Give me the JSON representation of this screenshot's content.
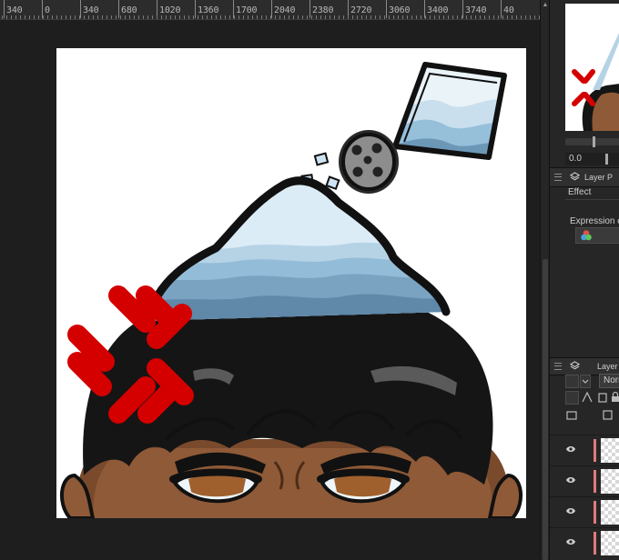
{
  "ruler": {
    "labels": [
      "340",
      "0",
      "340",
      "680",
      "1020",
      "1360",
      "1700",
      "2040",
      "2380",
      "2720",
      "3060",
      "3400",
      "3740",
      "40"
    ]
  },
  "panels": {
    "layer_property_title": "Layer P",
    "effect_label": "Effect",
    "expression_color_label": "Expression co",
    "layer_panel_title": "Layer",
    "rotate_value": "0.0",
    "blend_mode": "Norm"
  },
  "icons": {
    "panel_grip": "menu-grip-icon",
    "layer": "layer-stack-icon",
    "eye": "eye-icon",
    "color_wheel": "color-circles-icon"
  },
  "colors": {
    "app_bg": "#1b1b1b",
    "ruler_bg": "#2c2c2c",
    "panel_bg": "#262626",
    "canvas_bg": "#ffffff",
    "layer_marker": "#e27a7a",
    "anger_mark": "#d40000",
    "salt_blue": "#8fb9d6"
  },
  "layers": [
    {
      "visible": true
    },
    {
      "visible": true
    },
    {
      "visible": true
    },
    {
      "visible": true
    }
  ]
}
